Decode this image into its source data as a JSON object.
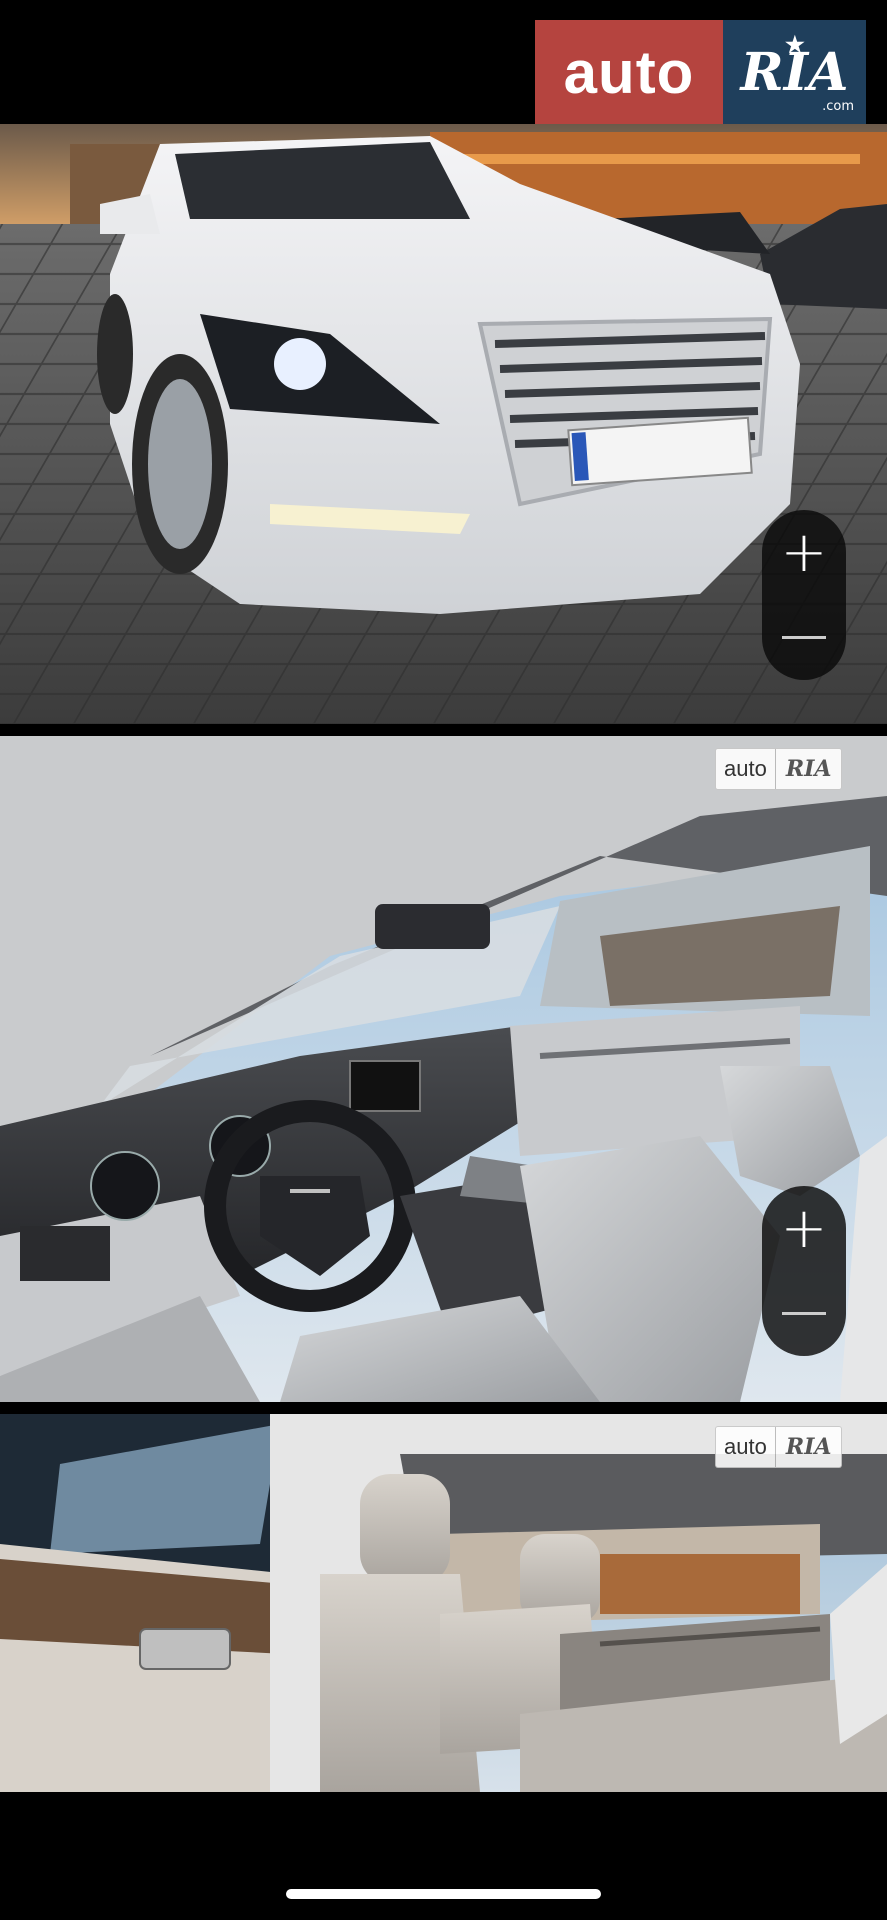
{
  "header": {
    "logo_auto": "auto",
    "logo_ria": "RIA",
    "logo_domain": ".com"
  },
  "gallery": {
    "photos": [
      {
        "subject": "White Genesis sedan front view in parking lot",
        "zoom_in": "+",
        "zoom_out": "−"
      },
      {
        "subject": "Car interior, dashboard and front seats",
        "watermark_auto": "auto",
        "watermark_ria": "RIA",
        "zoom_in": "+",
        "zoom_out": "−"
      },
      {
        "subject": "Car interior, rear seats",
        "watermark_auto": "auto",
        "watermark_ria": "RIA"
      }
    ]
  },
  "colors": {
    "logo_red": "#b5443f",
    "logo_blue": "#1f3f5c",
    "background": "#000000"
  }
}
